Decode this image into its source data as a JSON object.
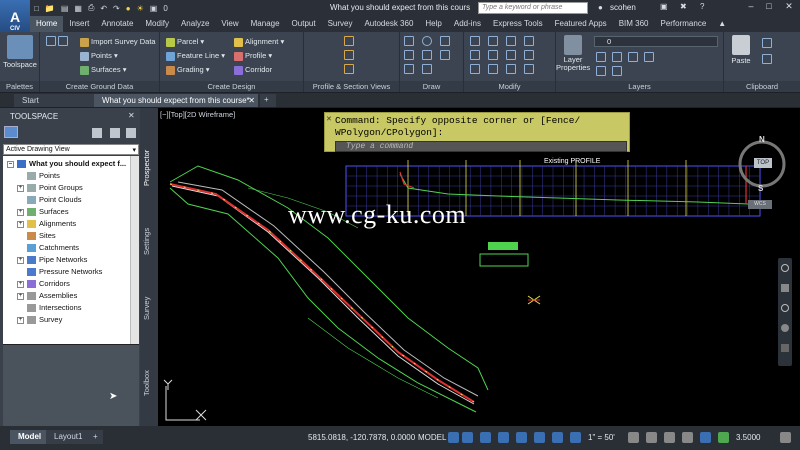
{
  "titlebar": {
    "app_letter": "A",
    "app_caption": "CIV",
    "qat_layer": "0",
    "title": "What you should expect from this course...",
    "search_placeholder": "Type a keyword or phrase",
    "user": "scohen"
  },
  "ribbon_tabs": [
    "Home",
    "Insert",
    "Annotate",
    "Modify",
    "Analyze",
    "View",
    "Manage",
    "Output",
    "Survey",
    "Autodesk 360",
    "Help",
    "Add-ins",
    "Express Tools",
    "Featured Apps",
    "BIM 360",
    "Performance"
  ],
  "ribbon": {
    "toolspace_btn": "Toolspace",
    "import_survey": "Import Survey Data",
    "points": "Points",
    "surfaces": "Surfaces",
    "parcel": "Parcel",
    "feature_line": "Feature Line",
    "grading": "Grading",
    "alignment": "Alignment",
    "profile": "Profile",
    "corridor": "Corridor",
    "layer_properties": "Layer Properties",
    "layer_combo": "0",
    "paste": "Paste",
    "groups": [
      "Palettes",
      "Create Ground Data",
      "Create Design",
      "Profile & Section Views",
      "Draw",
      "Modify",
      "Layers",
      "Clipboard"
    ]
  },
  "doc_tabs": {
    "start": "Start",
    "current": "What you should expect from this course*",
    "add": "+"
  },
  "toolspace": {
    "title": "TOOLSPACE",
    "view": "Active Drawing View",
    "root": "What you should expect f...",
    "items": [
      "Points",
      "Point Groups",
      "Point Clouds",
      "Surfaces",
      "Alignments",
      "Sites",
      "Catchments",
      "Pipe Networks",
      "Pressure Networks",
      "Corridors",
      "Assemblies",
      "Intersections",
      "Survey"
    ],
    "side_tabs": [
      "Prospector",
      "Settings",
      "Survey",
      "Toolbox"
    ]
  },
  "canvas": {
    "view_label": "[−][Top][2D Wireframe]",
    "command_line1": "Command: Specify opposite corner or [Fence/",
    "command_line2": "WPolygon/CPolygon]:",
    "command_placeholder": "Type a command",
    "watermark": "www.cg-ku.com",
    "profile_label": "Existing PROFILE",
    "compass_n": "N",
    "compass_s": "S",
    "compass_top": "TOP",
    "wcs": "WCS"
  },
  "layout_tabs": [
    "Model",
    "Layout1",
    "+"
  ],
  "status": {
    "coords": "5815.0818, -120.7878, 0.0000",
    "space": "MODEL",
    "scale": "1\" = 50'",
    "value": "3.5000"
  },
  "colors": {
    "accent": "#4a5561",
    "cmd_bg": "#c8c864",
    "corridor_green": "#4fd34f",
    "alignment_red": "#e03030",
    "grid_blue": "#5050ff"
  }
}
